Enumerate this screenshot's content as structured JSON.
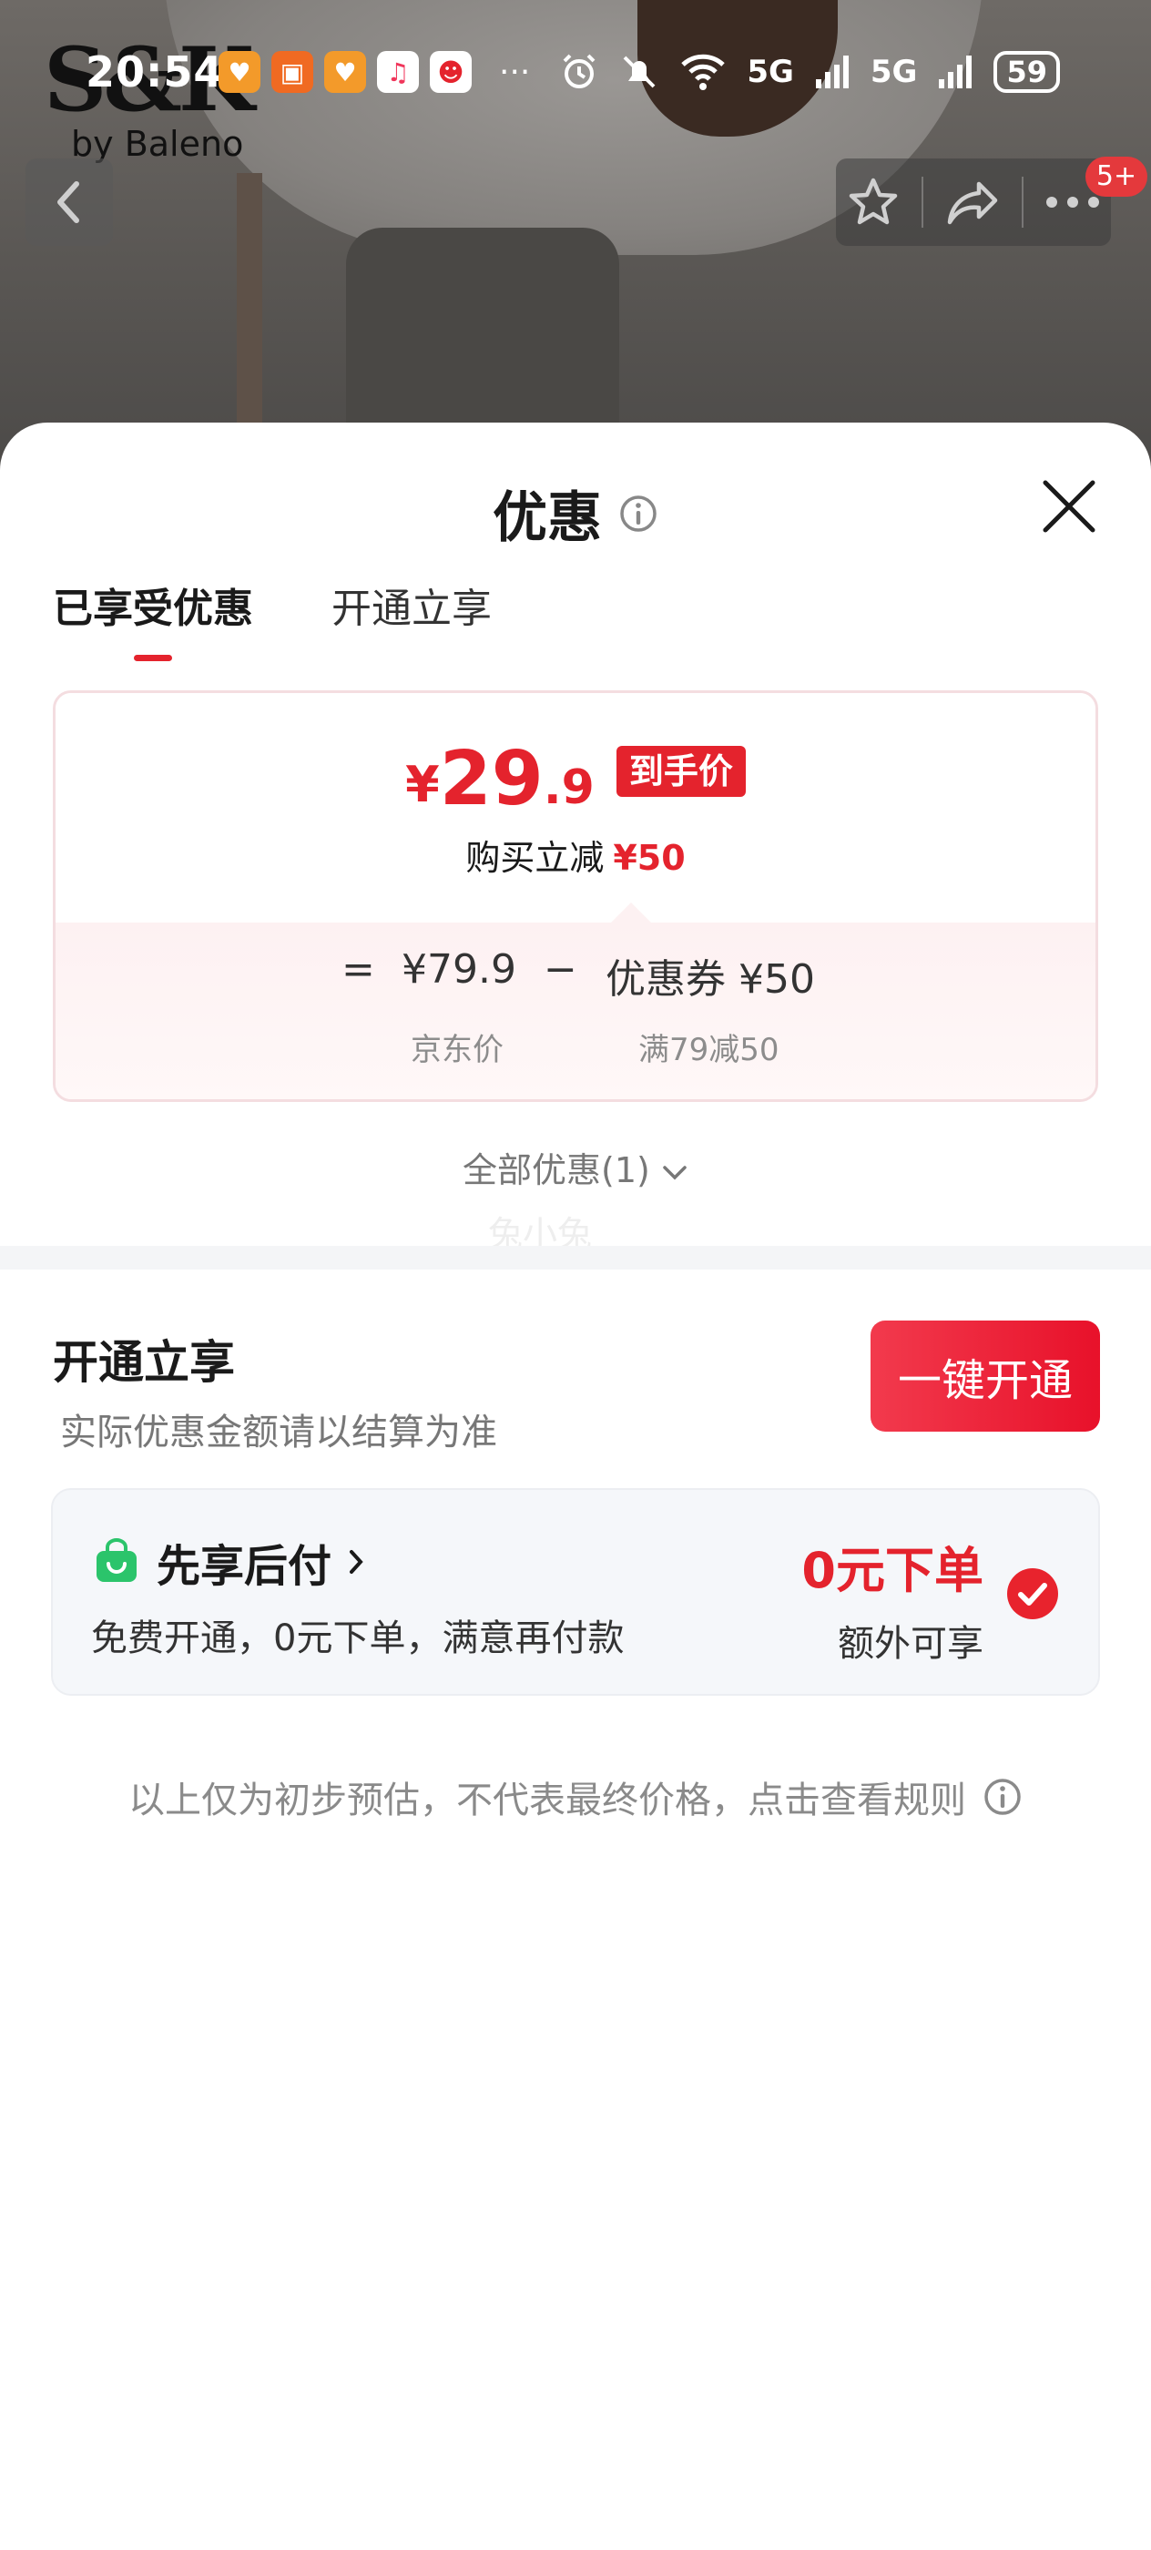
{
  "status_bar": {
    "time": "20:54",
    "more": "···",
    "network_1": "5G",
    "network_2": "5G",
    "battery": "59"
  },
  "brand": {
    "logo_big": "S&K",
    "logo_small": "by Baleno"
  },
  "nav": {
    "badge": "5+"
  },
  "sheet": {
    "title": "优惠",
    "tabs": [
      {
        "label": "已享受优惠",
        "active": true
      },
      {
        "label": "开通立享",
        "active": false
      }
    ],
    "price_card": {
      "currency": "¥",
      "price_int": "29",
      "price_dec": ".9",
      "price_tag": "到手价",
      "sub_text": "购买立减",
      "sub_amount": "¥50",
      "equals": "=",
      "jd_price": "¥79.9",
      "minus": "−",
      "coupon": "优惠券 ¥50",
      "jd_price_label": "京东价",
      "coupon_label": "满79减50"
    },
    "all_discounts": "全部优惠(1)",
    "watermark": "兔小兔",
    "open_section": {
      "title": "开通立享",
      "subtitle": "实际优惠金额请以结算为准",
      "button": "一键开通"
    },
    "pay_later": {
      "title": "先享后付",
      "desc": "免费开通，0元下单，满意再付款",
      "highlight": "0元下单",
      "highlight_sub": "额外可享",
      "checked": true
    },
    "disclaimer": "以上仅为初步预估，不代表最终价格，点击查看规则"
  },
  "colors": {
    "accent_red": "#e4232d",
    "pay_green": "#2bc46b"
  }
}
